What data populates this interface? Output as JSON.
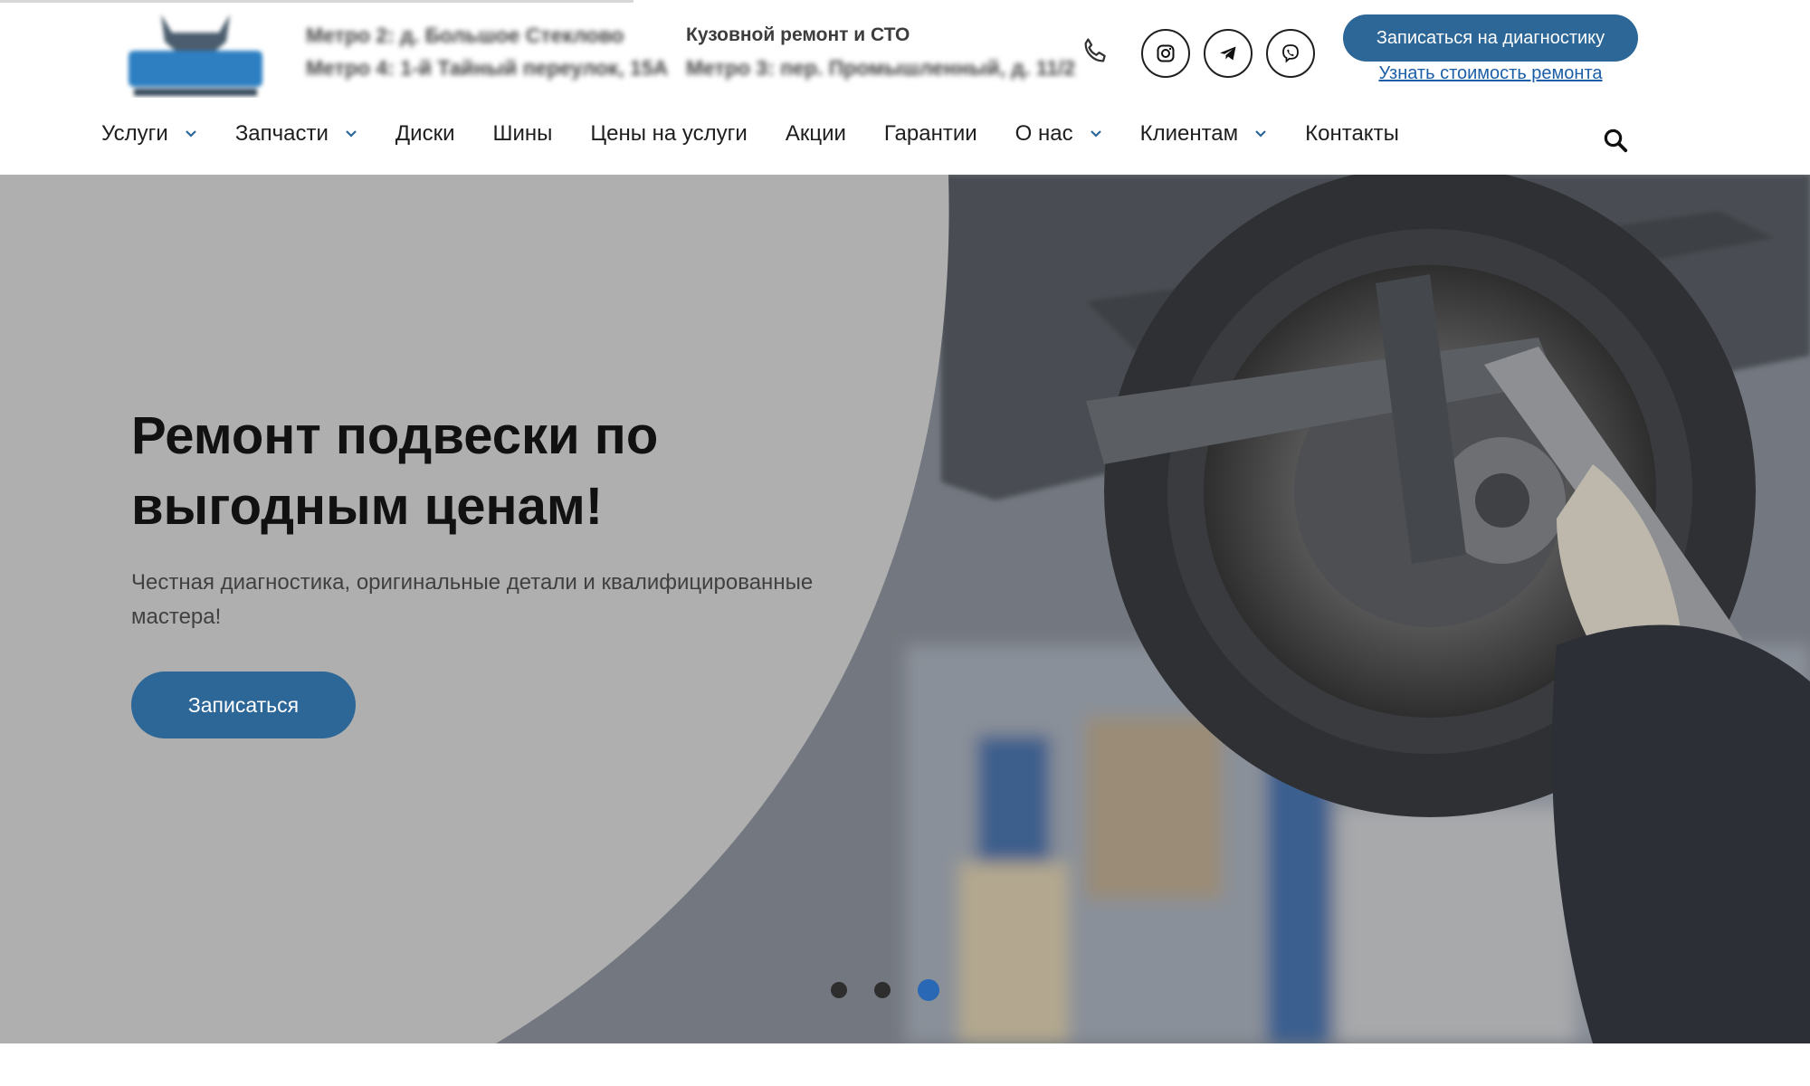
{
  "header": {
    "logo_alt": "logo",
    "address_line1": "Метро 2: д. Большое Стеклово",
    "address_line2": "Метро 4: 1-й Тайный переулок, 15А",
    "tagline": "Кузовной ремонт и СТО",
    "address_line3": "Метро 3: пер. Промышленный, д. 11/2",
    "cta_button": "Записаться на диагностику",
    "cta_link": "Узнать стоимость ремонта",
    "icons": [
      "phone-icon",
      "instagram-icon",
      "telegram-icon",
      "viber-icon"
    ],
    "accent_color": "#2c6797",
    "link_color": "#1b5fa8"
  },
  "nav": {
    "items": [
      {
        "label": "Услуги",
        "has_dropdown": true
      },
      {
        "label": "Запчасти",
        "has_dropdown": true
      },
      {
        "label": "Диски",
        "has_dropdown": false
      },
      {
        "label": "Шины",
        "has_dropdown": false
      },
      {
        "label": "Цены на услуги",
        "has_dropdown": false
      },
      {
        "label": "Акции",
        "has_dropdown": false
      },
      {
        "label": "Гарантии",
        "has_dropdown": false
      },
      {
        "label": "О нас",
        "has_dropdown": true
      },
      {
        "label": "Клиентам",
        "has_dropdown": true
      },
      {
        "label": "Контакты",
        "has_dropdown": false
      }
    ],
    "search_icon": "search-icon"
  },
  "hero": {
    "title": "Ремонт подвески по выгодным ценам!",
    "subtitle": "Честная диагностика, оригинальные детали и квалифицированные мастера!",
    "button": "Записаться",
    "slides": 3,
    "active_slide": 3,
    "active_dot_color": "#2968b5"
  }
}
